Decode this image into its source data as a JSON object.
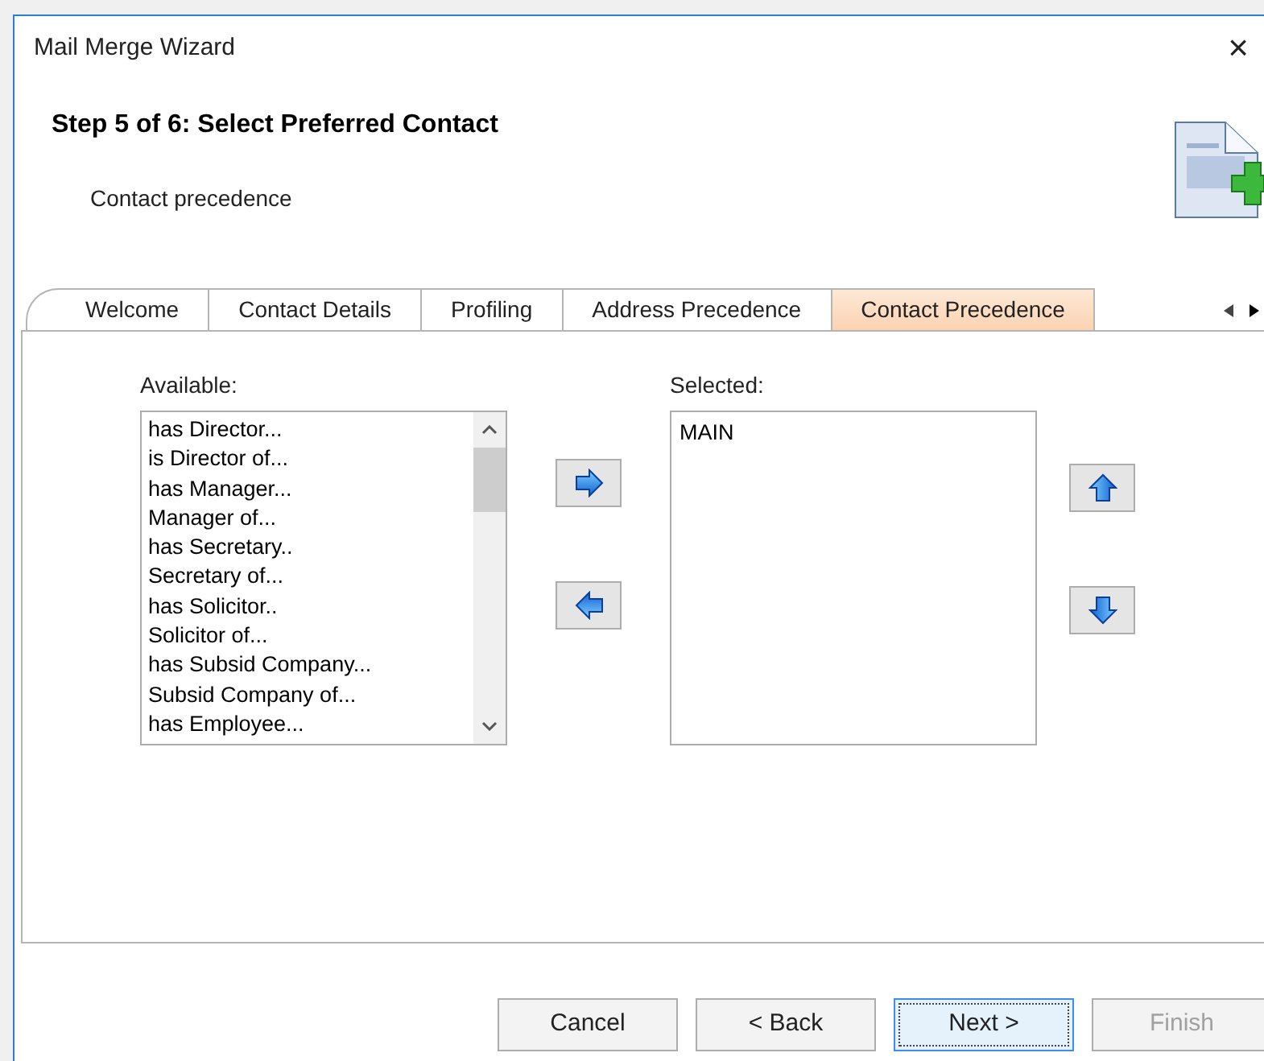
{
  "window": {
    "title": "Mail Merge Wizard",
    "close": "×"
  },
  "header": {
    "step": "Step 5 of 6: Select Preferred Contact",
    "subtitle": "Contact precedence"
  },
  "tabs": [
    {
      "label": "Welcome",
      "selected": false
    },
    {
      "label": "Contact Details",
      "selected": false
    },
    {
      "label": "Profiling",
      "selected": false
    },
    {
      "label": "Address Precedence",
      "selected": false
    },
    {
      "label": "Contact Precedence",
      "selected": true
    }
  ],
  "available": {
    "label": "Available:",
    "items": [
      "has Director...",
      "is Director of...",
      "has Manager...",
      "Manager of...",
      "has Secretary..",
      "Secretary of...",
      "has Solicitor..",
      "Solicitor of...",
      "has Subsid Company...",
      "Subsid Company of...",
      "has Employee..."
    ]
  },
  "selected_list": {
    "label": "Selected:",
    "items": [
      "MAIN"
    ]
  },
  "buttons": [
    {
      "label": "Cancel",
      "disabled": false,
      "selected": false
    },
    {
      "label": "< Back",
      "disabled": false,
      "selected": false
    },
    {
      "label": "Next >",
      "disabled": false,
      "selected": true
    },
    {
      "label": "Finish",
      "disabled": true,
      "selected": false
    }
  ]
}
